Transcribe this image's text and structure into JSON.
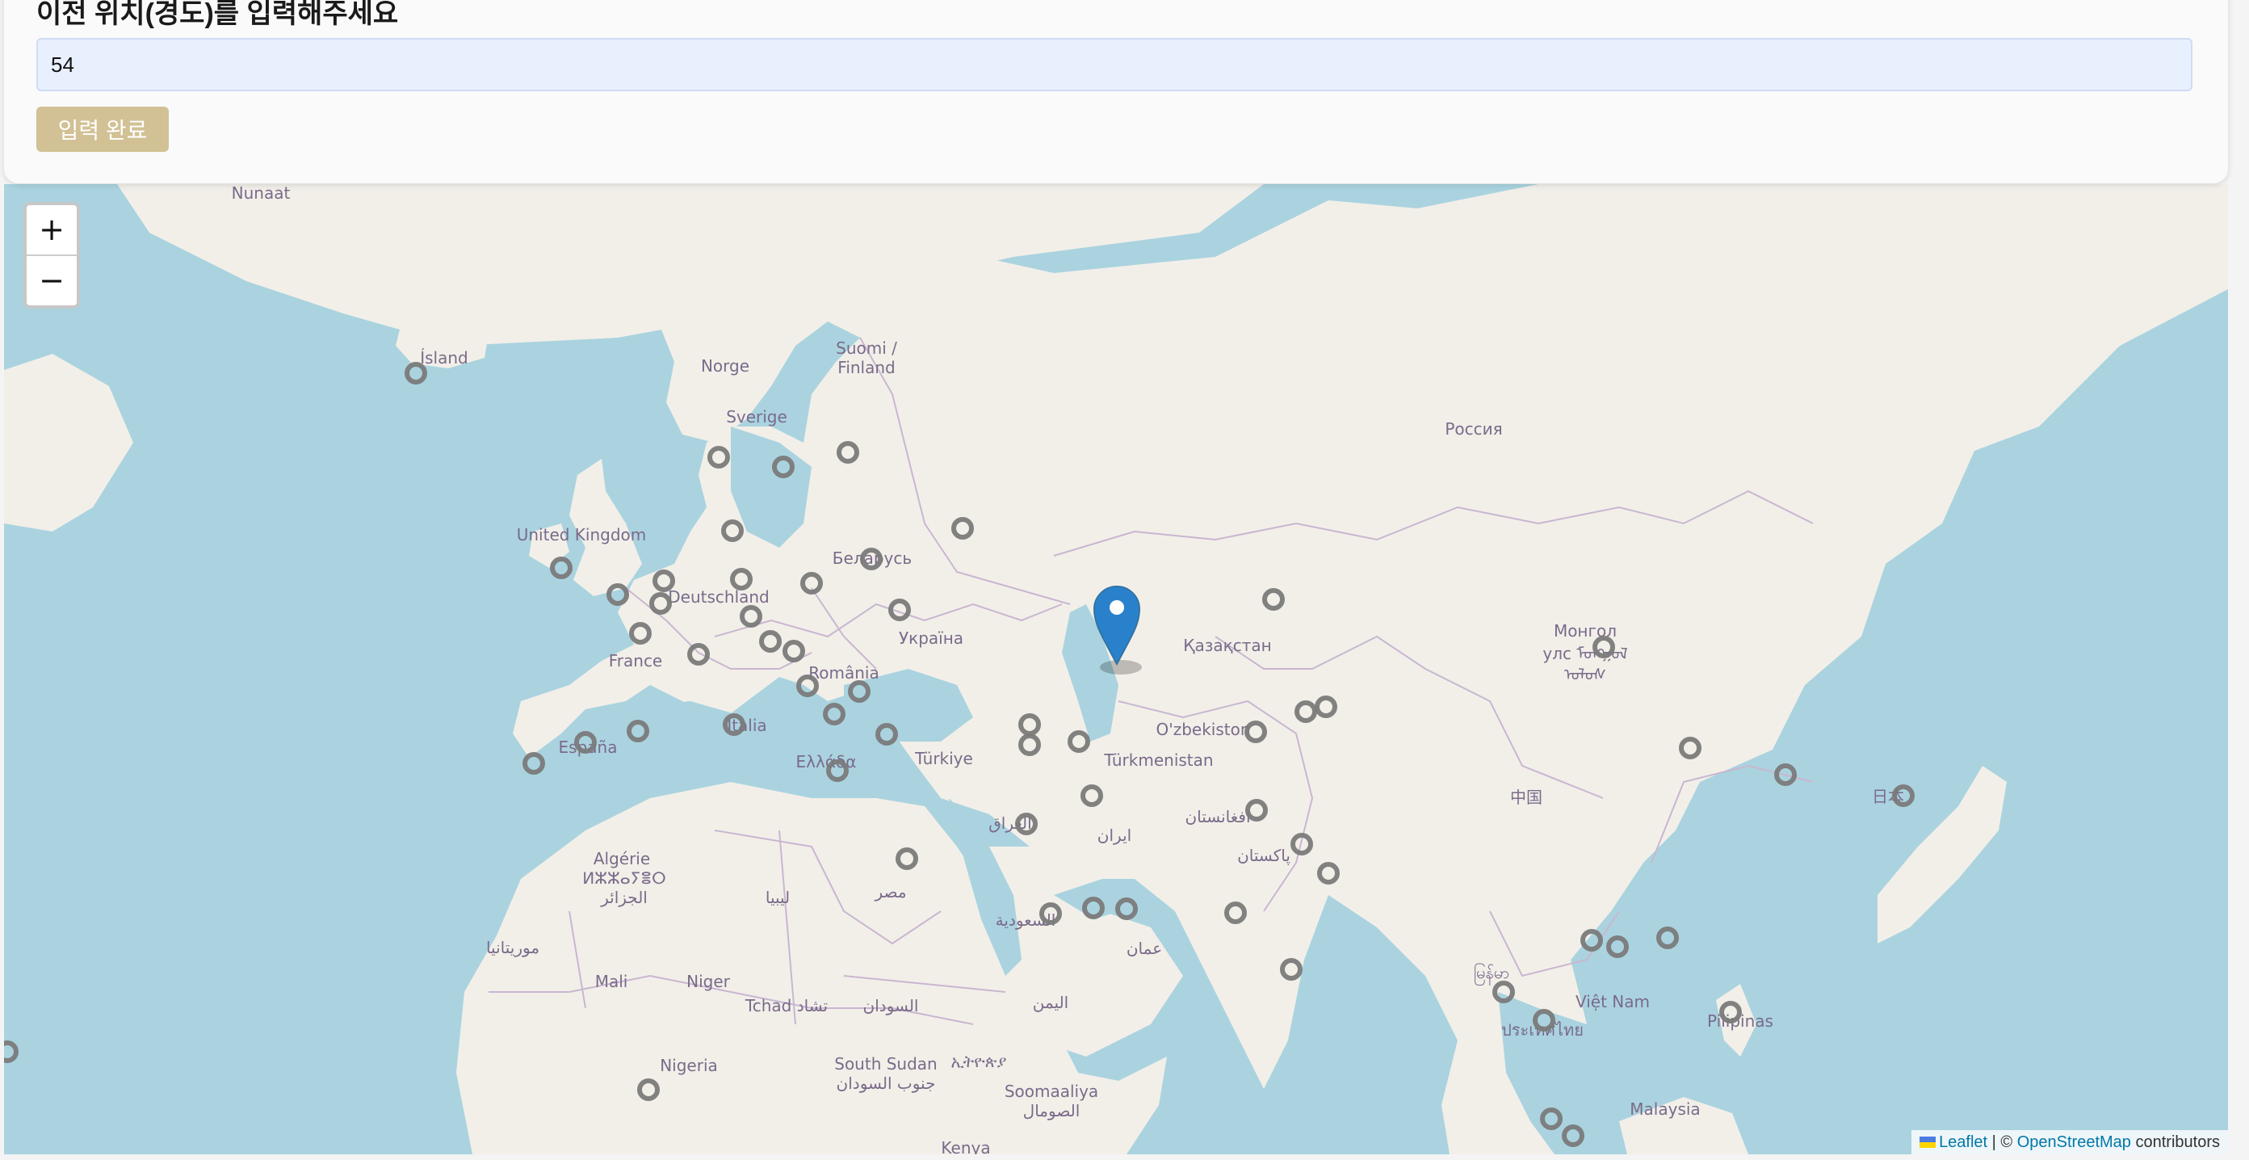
{
  "form": {
    "title": "이전 위치(경도)를 입력해주세요",
    "input_value": "54",
    "submit_label": "입력 완료"
  },
  "map": {
    "zoom_in_label": "+",
    "zoom_out_label": "−",
    "labels": [
      {
        "text": "Nunaat"
      },
      {
        "text": "Ísland"
      },
      {
        "text": "Norge"
      },
      {
        "text": "Sverige"
      },
      {
        "text": "Suomi /"
      },
      {
        "text": "Finland"
      },
      {
        "text": "Россия"
      },
      {
        "text": "United Kingdom"
      },
      {
        "text": "Deutschland"
      },
      {
        "text": "Беларусь"
      },
      {
        "text": "France"
      },
      {
        "text": "Україна"
      },
      {
        "text": "România"
      },
      {
        "text": "Қазақстан"
      },
      {
        "text": "Монгол"
      },
      {
        "text": "улс ᠮᠣᠩᠭᠣᠯ"
      },
      {
        "text": "ᠤᠯᠤᠰ"
      },
      {
        "text": "España"
      },
      {
        "text": "Italia"
      },
      {
        "text": "Ελλάδα"
      },
      {
        "text": "Türkiye"
      },
      {
        "text": "O'zbekiston"
      },
      {
        "text": "Türkmenistan"
      },
      {
        "text": "中国"
      },
      {
        "text": "日本"
      },
      {
        "text": "Algérie"
      },
      {
        "text": "ⵍⵣⵣⴰⵢⴻⵔ"
      },
      {
        "text": "الجزائر"
      },
      {
        "text": "ليبيا"
      },
      {
        "text": "مصر"
      },
      {
        "text": "العراق"
      },
      {
        "text": "ایران"
      },
      {
        "text": "افغانستان"
      },
      {
        "text": "پاکستان"
      },
      {
        "text": "السعودية"
      },
      {
        "text": "عمان"
      },
      {
        "text": "موريتانيا"
      },
      {
        "text": "Mali"
      },
      {
        "text": "Niger"
      },
      {
        "text": "Tchad تشاد"
      },
      {
        "text": "السودان"
      },
      {
        "text": "اليمن"
      },
      {
        "text": "Nigeria"
      },
      {
        "text": "South Sudan"
      },
      {
        "text": "جنوب السودان"
      },
      {
        "text": "ኢትዮጵያ"
      },
      {
        "text": "Soomaaliya"
      },
      {
        "text": "الصومال"
      },
      {
        "text": "Việt Nam"
      },
      {
        "text": "ประเทศไทย"
      },
      {
        "text": "မြန်မာ"
      },
      {
        "text": "Pilipinas"
      },
      {
        "text": "Malaysia"
      },
      {
        "text": "Kenya"
      }
    ],
    "attribution": {
      "leaflet": "Leaflet",
      "separator": " | © ",
      "osm": "OpenStreetMap",
      "suffix": " contributors"
    }
  }
}
